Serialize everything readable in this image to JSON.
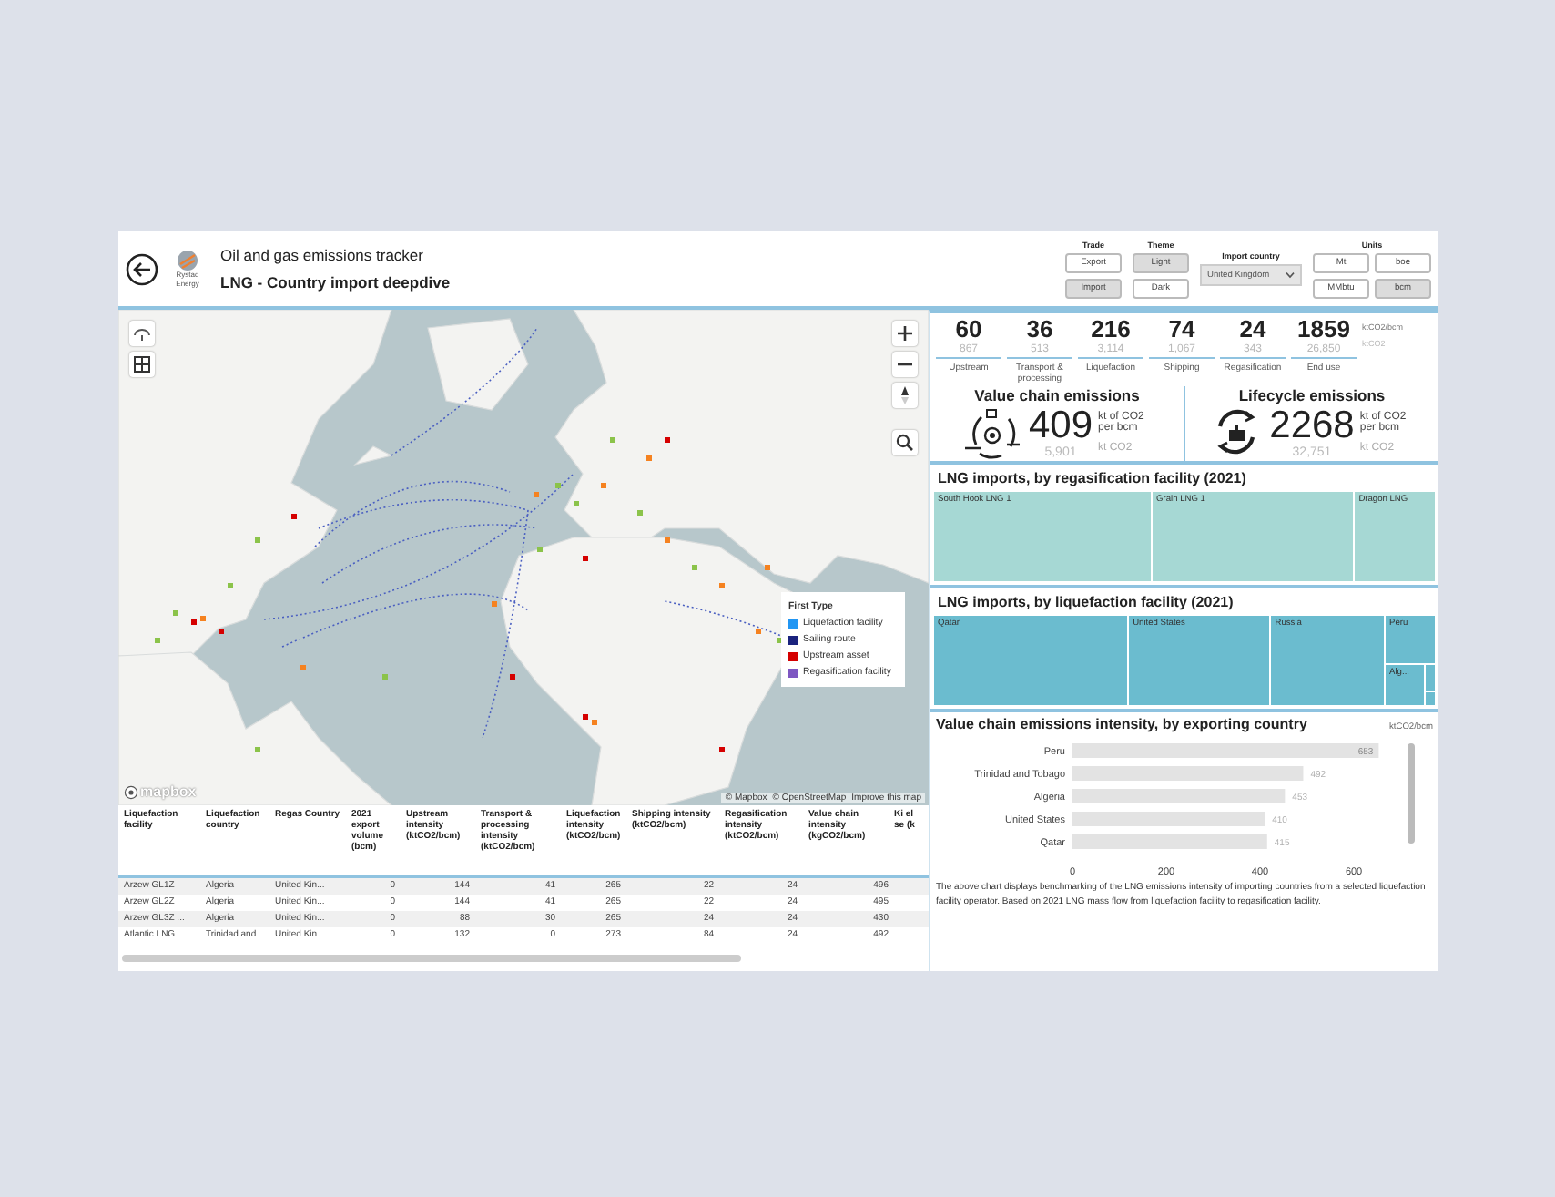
{
  "header": {
    "brand": "Rystad Energy",
    "title": "Oil and gas emissions tracker",
    "subtitle": "LNG - Country import deepdive"
  },
  "filters": {
    "trade": {
      "label": "Trade",
      "options": [
        {
          "label": "Export",
          "selected": false
        },
        {
          "label": "Import",
          "selected": true
        }
      ]
    },
    "theme": {
      "label": "Theme",
      "options": [
        {
          "label": "Light",
          "selected": true
        },
        {
          "label": "Dark",
          "selected": false
        }
      ]
    },
    "import_country": {
      "label": "Import country",
      "value": "United Kingdom"
    },
    "units": {
      "label": "Units",
      "options": [
        {
          "label": "Mt",
          "selected": false
        },
        {
          "label": "boe",
          "selected": false
        },
        {
          "label": "MMbtu",
          "selected": false
        },
        {
          "label": "bcm",
          "selected": true
        }
      ]
    }
  },
  "map": {
    "legend": {
      "title": "First Type",
      "items": [
        {
          "label": "Liquefaction facility",
          "color": "#2196f3"
        },
        {
          "label": "Sailing route",
          "color": "#1a237e"
        },
        {
          "label": "Upstream asset",
          "color": "#d50000"
        },
        {
          "label": "Regasification facility",
          "color": "#7e57c2"
        }
      ]
    },
    "logo": "mapbox",
    "attribution": [
      "© Mapbox",
      "© OpenStreetMap",
      "Improve this map"
    ]
  },
  "table": {
    "columns": [
      "Liquefaction facility",
      "Liquefaction country",
      "Regas Country",
      "2021 export volume (bcm)",
      "Upstream intensity (ktCO2/bcm)",
      "Transport & processing intensity (ktCO2/bcm)",
      "Liquefaction intensity (ktCO2/bcm)",
      "Shipping intensity (ktCO2/bcm)",
      "Regasification intensity (ktCO2/bcm)",
      "Value chain intensity (kgCO2/bcm)",
      "Ki el se (k"
    ],
    "rows": [
      [
        "Arzew GL1Z",
        "Algeria",
        "United Kin...",
        "0",
        "144",
        "41",
        "265",
        "22",
        "24",
        "496"
      ],
      [
        "Arzew GL2Z",
        "Algeria",
        "United Kin...",
        "0",
        "144",
        "41",
        "265",
        "22",
        "24",
        "495"
      ],
      [
        "Arzew GL3Z ...",
        "Algeria",
        "United Kin...",
        "0",
        "88",
        "30",
        "265",
        "24",
        "24",
        "430"
      ],
      [
        "Atlantic LNG",
        "Trinidad and...",
        "United Kin...",
        "0",
        "132",
        "0",
        "273",
        "84",
        "24",
        "492"
      ]
    ]
  },
  "kpis": {
    "items": [
      {
        "value": "60",
        "total": "867",
        "label": "Upstream"
      },
      {
        "value": "36",
        "total": "513",
        "label": "Transport & processing"
      },
      {
        "value": "216",
        "total": "3,114",
        "label": "Liquefaction"
      },
      {
        "value": "74",
        "total": "1,067",
        "label": "Shipping"
      },
      {
        "value": "24",
        "total": "343",
        "label": "Regasification"
      },
      {
        "value": "1859",
        "total": "26,850",
        "label": "End use"
      }
    ],
    "value_unit": "ktCO2/bcm",
    "total_unit": "ktCO2"
  },
  "summaries": [
    {
      "kind": "value_chain",
      "title": "Value chain emissions",
      "value": "409",
      "unit": "kt of CO2 per bcm",
      "total": "5,901",
      "total_unit": "kt CO2"
    },
    {
      "kind": "lifecycle",
      "title": "Lifecycle emissions",
      "value": "2268",
      "unit": "kt of CO2 per bcm",
      "total": "32,751",
      "total_unit": "kt CO2"
    }
  ],
  "treemaps": [
    {
      "title": "LNG imports, by regasification facility (2021)",
      "tiles": [
        {
          "label": "South Hook LNG 1"
        },
        {
          "label": "Grain LNG 1"
        },
        {
          "label": "Dragon LNG"
        }
      ]
    },
    {
      "title": "LNG imports, by liquefaction facility (2021)",
      "tiles": [
        {
          "label": "Qatar"
        },
        {
          "label": "United States"
        },
        {
          "label": "Russia"
        },
        {
          "label": "Peru"
        },
        {
          "label": "Alg..."
        }
      ]
    }
  ],
  "intensity_chart": {
    "unit": "ktCO2/bcm",
    "chart_data": {
      "type": "bar",
      "orientation": "horizontal",
      "title": "Value chain emissions intensity, by exporting country",
      "categories": [
        "Peru",
        "Trinidad and Tobago",
        "Algeria",
        "United States",
        "Qatar"
      ],
      "values": [
        653,
        492,
        453,
        410,
        415
      ],
      "xlim": [
        0,
        660
      ],
      "xticks": [
        0,
        200,
        400,
        600
      ],
      "data_labels": true
    },
    "note": "The above chart displays benchmarking of the LNG emissions intensity of importing countries from a selected liquefaction facility operator. Based on 2021 LNG mass flow from liquefaction facility to regasification facility."
  }
}
